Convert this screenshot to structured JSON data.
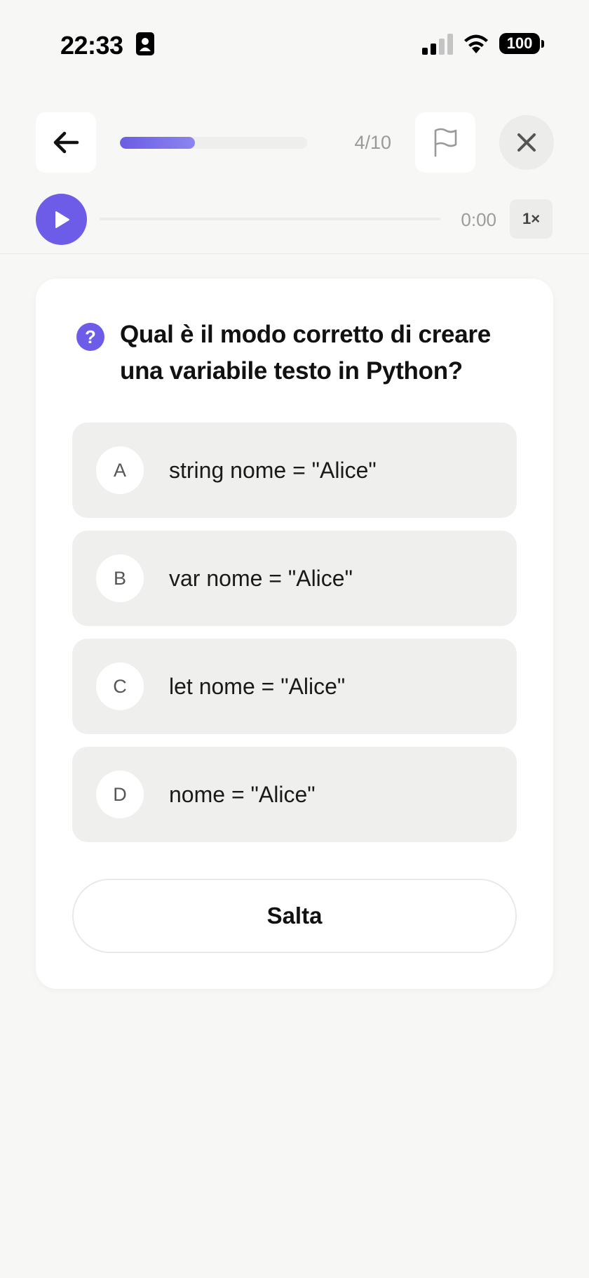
{
  "status_bar": {
    "time": "22:33",
    "battery": "100",
    "icons": [
      "contact-card-icon",
      "cellular-signal-icon",
      "wifi-icon",
      "battery-icon"
    ]
  },
  "header": {
    "progress": {
      "current": 4,
      "total": 10,
      "fraction": 0.4,
      "label": "4/10"
    },
    "icons": [
      "arrow-left-icon",
      "flag-icon",
      "close-icon"
    ],
    "accent_color": "#6c5ce7"
  },
  "audio": {
    "time": "0:00",
    "speed": "1×",
    "position_fraction": 0
  },
  "question": {
    "text": "Qual è il modo corretto di creare una variabile testo in Python?",
    "icon_glyph": "?"
  },
  "options": [
    {
      "letter": "A",
      "text": "string nome = \"Alice\""
    },
    {
      "letter": "B",
      "text": "var nome = \"Alice\""
    },
    {
      "letter": "C",
      "text": "let nome = \"Alice\""
    },
    {
      "letter": "D",
      "text": "nome = \"Alice\""
    }
  ],
  "actions": {
    "skip_label": "Salta"
  }
}
